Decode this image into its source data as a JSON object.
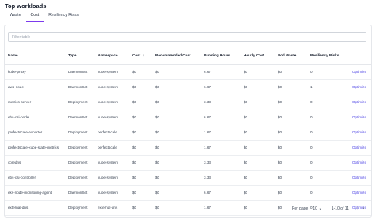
{
  "title": "Top workloads",
  "tabs": [
    {
      "label": "Waste",
      "active": false
    },
    {
      "label": "Cost",
      "active": true
    },
    {
      "label": "Resiliency Risks",
      "active": false
    }
  ],
  "filter": {
    "placeholder": "Filter table"
  },
  "columns": [
    "Name",
    "Type",
    "Namespace",
    "Cost",
    "Recommended Cost",
    "Running Hours",
    "Hourly Cost",
    "Pod Waste",
    "Resiliency Risks"
  ],
  "sort_icon": "arrow-down-icon",
  "action_label": "Optimize",
  "rows": [
    {
      "name": "kube-proxy",
      "type": "DaemonSet",
      "namespace": "kube-system",
      "cost": "$0",
      "recommended_cost": "$0",
      "running_hours": "6.67",
      "hourly_cost": "$0",
      "pod_waste": "$0",
      "resiliency_risks": "0"
    },
    {
      "name": "aws-node",
      "type": "DaemonSet",
      "namespace": "kube-system",
      "cost": "$0",
      "recommended_cost": "$0",
      "running_hours": "6.67",
      "hourly_cost": "$0",
      "pod_waste": "$0",
      "resiliency_risks": "1"
    },
    {
      "name": "metrics-server",
      "type": "Deployment",
      "namespace": "kube-system",
      "cost": "$0",
      "recommended_cost": "$0",
      "running_hours": "3.33",
      "hourly_cost": "$0",
      "pod_waste": "$0",
      "resiliency_risks": "0"
    },
    {
      "name": "ebs-csi-node",
      "type": "DaemonSet",
      "namespace": "kube-system",
      "cost": "$0",
      "recommended_cost": "$0",
      "running_hours": "6.67",
      "hourly_cost": "$0",
      "pod_waste": "$0",
      "resiliency_risks": "0"
    },
    {
      "name": "perfectscale-exporter",
      "type": "Deployment",
      "namespace": "perfectscale",
      "cost": "$0",
      "recommended_cost": "$0",
      "running_hours": "1.67",
      "hourly_cost": "$0",
      "pod_waste": "$0",
      "resiliency_risks": "0"
    },
    {
      "name": "perfectscale-kube-state-metrics",
      "type": "Deployment",
      "namespace": "perfectscale",
      "cost": "$0",
      "recommended_cost": "$0",
      "running_hours": "1.67",
      "hourly_cost": "$0",
      "pod_waste": "$0",
      "resiliency_risks": "0"
    },
    {
      "name": "coredns",
      "type": "Deployment",
      "namespace": "kube-system",
      "cost": "$0",
      "recommended_cost": "$0",
      "running_hours": "3.33",
      "hourly_cost": "$0",
      "pod_waste": "$0",
      "resiliency_risks": "0"
    },
    {
      "name": "ebs-csi-controller",
      "type": "Deployment",
      "namespace": "kube-system",
      "cost": "$0",
      "recommended_cost": "$0",
      "running_hours": "3.33",
      "hourly_cost": "$0",
      "pod_waste": "$0",
      "resiliency_risks": "0"
    },
    {
      "name": "eks-node-monitoring-agent",
      "type": "DaemonSet",
      "namespace": "kube-system",
      "cost": "$0",
      "recommended_cost": "$0",
      "running_hours": "6.67",
      "hourly_cost": "$0",
      "pod_waste": "$0",
      "resiliency_risks": "0"
    },
    {
      "name": "external-dns",
      "type": "Deployment",
      "namespace": "external-dns",
      "cost": "$0",
      "recommended_cost": "$0",
      "running_hours": "1.67",
      "hourly_cost": "$0",
      "pod_waste": "$0",
      "resiliency_risks": "0"
    }
  ],
  "pagination": {
    "per_page_label": "Per page",
    "per_page_value": "10",
    "range_text": "1-10 of 11",
    "prev_icon": "chevron-left-icon",
    "next_icon": "chevron-right-icon"
  },
  "colors": {
    "accent": "#7c3aed",
    "link": "#4f46e5",
    "border": "#e5e7eb"
  }
}
